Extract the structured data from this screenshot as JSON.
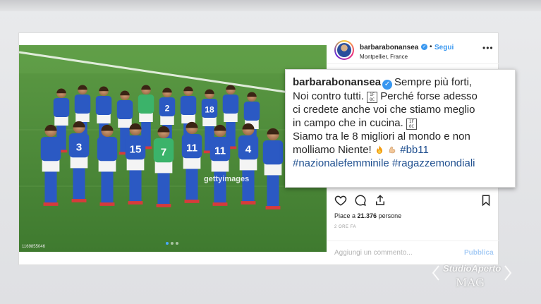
{
  "post": {
    "username": "barbarabonansea",
    "follow_label": "Segui",
    "location": "Montpellier, France",
    "more_icon": "more-dots-icon",
    "photo": {
      "watermark": "gettyimages",
      "id_text": "1169855046",
      "carousel_count": 3,
      "carousel_active": 1,
      "shirt_numbers": [
        "3",
        "15",
        "11",
        "11",
        "4",
        "2",
        "18",
        "7"
      ]
    },
    "likes_label": "Piace a ",
    "likes_count": "21.376",
    "likes_suffix": " persone",
    "time": "2 ORE FA",
    "comment_placeholder": "Aggiungi un commento...",
    "publish_label": "Pubblica"
  },
  "caption": {
    "username": "barbarabonansea",
    "line1": "Sempre più forti,",
    "line2": "Noi contro tutti.",
    "line2b": "Perché forse adesso",
    "line3": "ci credete anche voi che stiamo meglio",
    "line4": "in campo che in cucina.",
    "line5": "Siamo tra le 8 migliori al mondo e non",
    "line6": "molliamo Niente!",
    "tag1": "#bb11",
    "tag2": "#nazionalefemminile",
    "tag3": "#ragazzemondiali",
    "box_glyph": "1F\n0C"
  },
  "broadcaster": {
    "line1": "StudioAperto",
    "line2": "MAG"
  },
  "colors": {
    "accent_blue": "#3897f0",
    "shirt_blue": "#2b59c3",
    "pitch_green": "#4f8a3a"
  }
}
